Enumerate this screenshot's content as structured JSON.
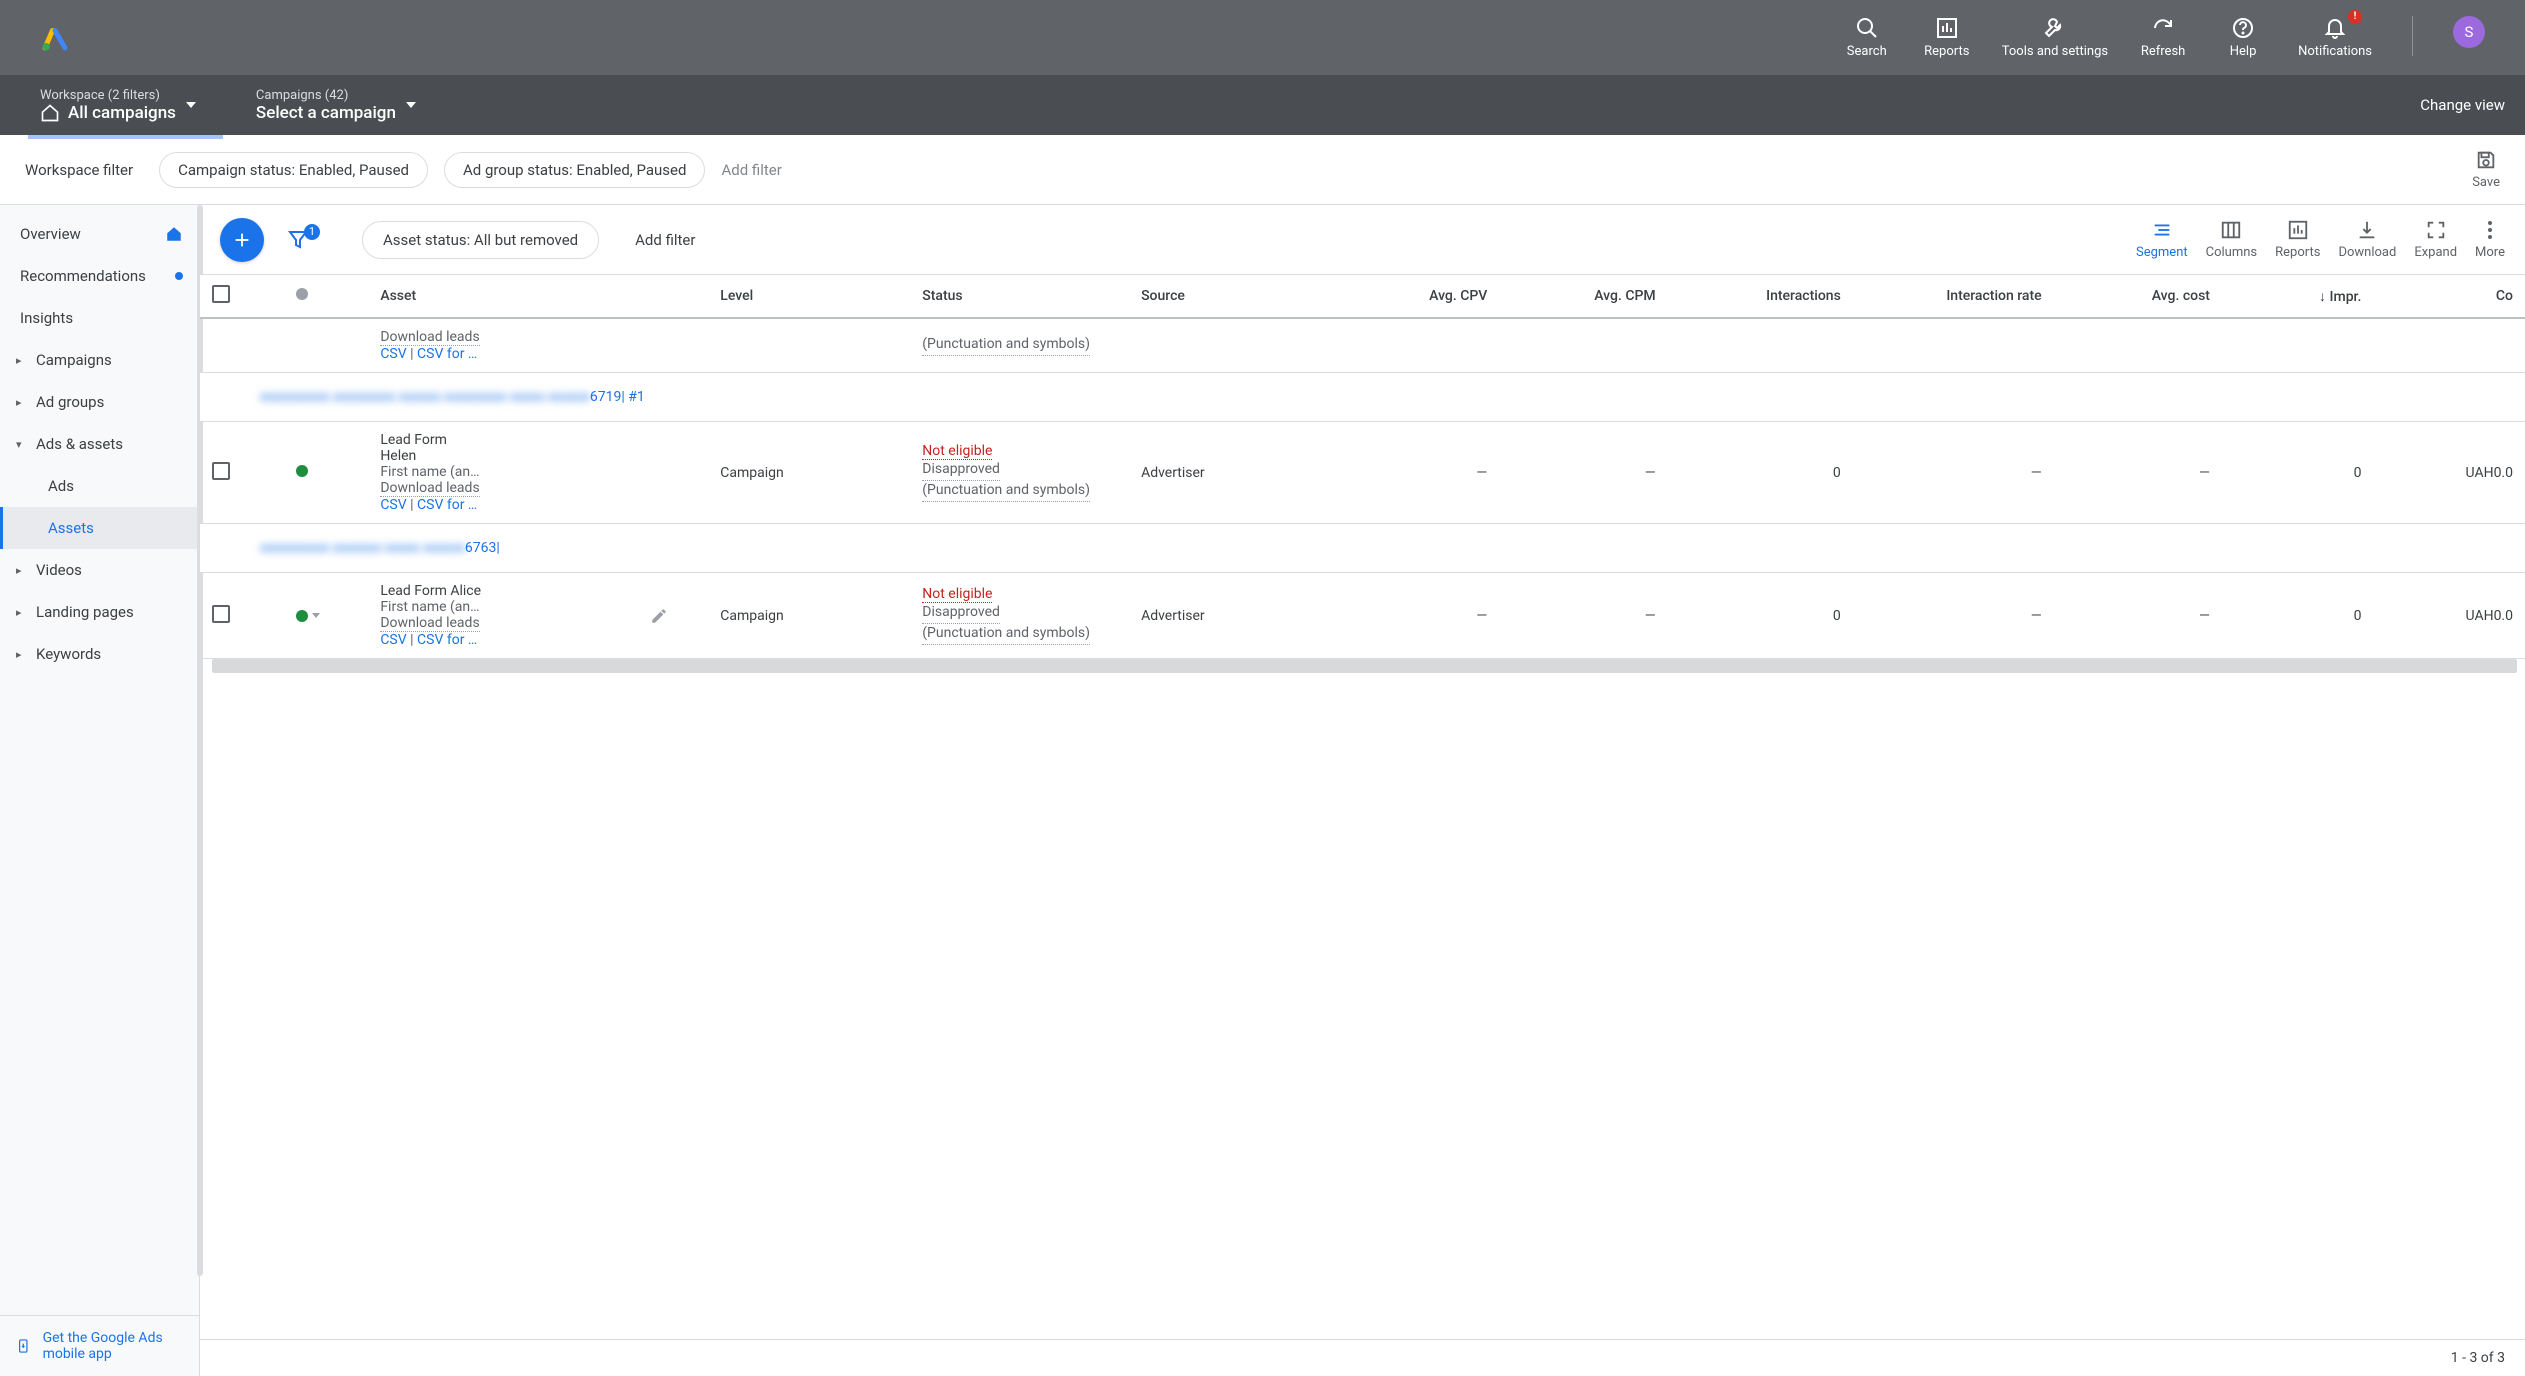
{
  "header": {
    "actions": [
      {
        "icon": "search",
        "label": "Search"
      },
      {
        "icon": "reports",
        "label": "Reports"
      },
      {
        "icon": "tools",
        "label": "Tools and settings"
      },
      {
        "icon": "refresh",
        "label": "Refresh"
      },
      {
        "icon": "help",
        "label": "Help"
      },
      {
        "icon": "notifications",
        "label": "Notifications",
        "badge": "!"
      }
    ],
    "avatar": "S"
  },
  "breadcrumb": {
    "workspace_small": "Workspace (2 filters)",
    "workspace_big": "All campaigns",
    "campaigns_small": "Campaigns (42)",
    "campaigns_big": "Select a campaign",
    "change_view": "Change view"
  },
  "filter_bar": {
    "label": "Workspace filter",
    "chips": [
      "Campaign status: Enabled, Paused",
      "Ad group status: Enabled, Paused"
    ],
    "add_filter": "Add filter",
    "save": "Save"
  },
  "sidebar": {
    "overview": "Overview",
    "recommendations": "Recommendations",
    "insights": "Insights",
    "campaigns": "Campaigns",
    "ad_groups": "Ad groups",
    "ads_assets": "Ads & assets",
    "ads": "Ads",
    "assets": "Assets",
    "videos": "Videos",
    "landing_pages": "Landing pages",
    "keywords": "Keywords",
    "footer": "Get the Google Ads mobile app"
  },
  "toolbar": {
    "filter_badge": "1",
    "asset_status": "Asset status: All but removed",
    "add_filter": "Add filter",
    "actions": [
      {
        "label": "Segment",
        "active": true
      },
      {
        "label": "Columns"
      },
      {
        "label": "Reports"
      },
      {
        "label": "Download"
      },
      {
        "label": "Expand"
      },
      {
        "label": "More"
      }
    ]
  },
  "table": {
    "headers": {
      "asset": "Asset",
      "level": "Level",
      "status": "Status",
      "source": "Source",
      "avg_cpv": "Avg. CPV",
      "avg_cpm": "Avg. CPM",
      "interactions": "Interactions",
      "interaction_rate": "Interaction rate",
      "avg_cost": "Avg. cost",
      "impr": "Impr.",
      "cost": "Co"
    },
    "sort_indicator": "↓",
    "partial_row": {
      "download_leads": "Download leads",
      "csv": "CSV",
      "csv_for": "CSV for …",
      "status_detail": "(Punctuation and symbols)"
    },
    "groups": [
      {
        "suffix": "6719| #1"
      },
      {
        "suffix": "6763|"
      }
    ],
    "rows": [
      {
        "status_dot": "green",
        "title": "Lead Form",
        "name_line": "Helen",
        "sub": "First name (an…",
        "download_leads": "Download leads",
        "csv": "CSV",
        "csv_for": "CSV for …",
        "level": "Campaign",
        "not_eligible": "Not eligible",
        "disapproved": "Disapproved",
        "detail": "(Punctuation and symbols)",
        "source": "Advertiser",
        "avg_cpv": "—",
        "avg_cpm": "—",
        "interactions": "0",
        "interaction_rate": "—",
        "avg_cost": "—",
        "impr": "0",
        "cost": "UAH0.0",
        "editable": false
      },
      {
        "status_dot": "green",
        "title": "Lead Form Alice",
        "name_line": "",
        "sub": "First name (an…",
        "download_leads": "Download leads",
        "csv": "CSV",
        "csv_for": "CSV for …",
        "level": "Campaign",
        "not_eligible": "Not eligible",
        "disapproved": "Disapproved",
        "detail": "(Punctuation and symbols)",
        "source": "Advertiser",
        "avg_cpv": "—",
        "avg_cpm": "—",
        "interactions": "0",
        "interaction_rate": "—",
        "avg_cost": "—",
        "impr": "0",
        "cost": "UAH0.0",
        "editable": true
      }
    ]
  },
  "footer": {
    "pagination": "1 - 3 of 3"
  }
}
